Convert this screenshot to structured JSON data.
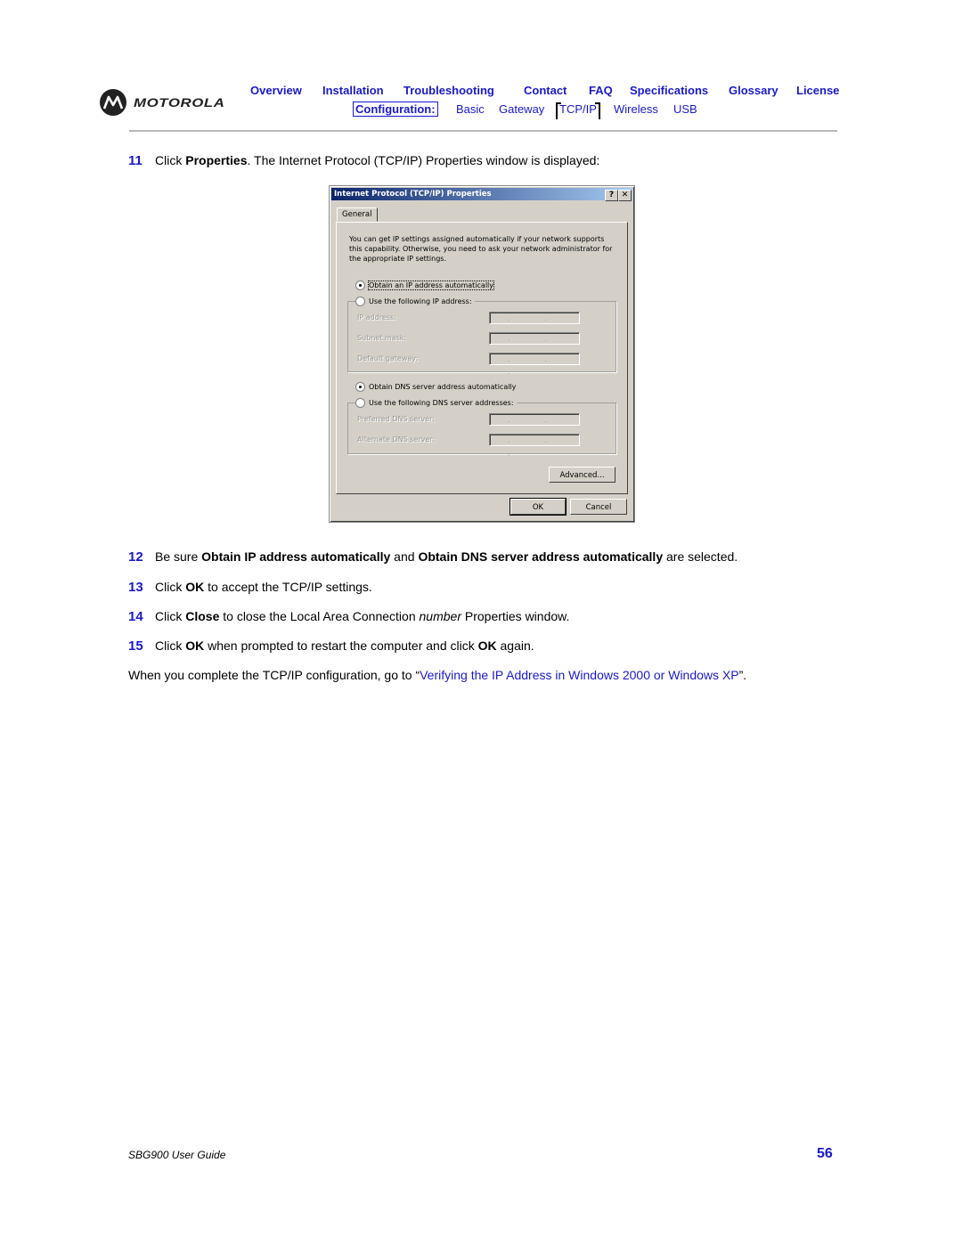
{
  "brand": {
    "name": "MOTOROLA",
    "icon": "motorola-batwing-logo"
  },
  "nav": {
    "top": [
      "Overview",
      "Installation",
      "Troubleshooting",
      "Contact",
      "FAQ",
      "Specifications",
      "Glossary",
      "License"
    ],
    "sub_label": "Configuration:",
    "sub": [
      "Basic",
      "Gateway",
      "TCP/IP",
      "Wireless",
      "USB"
    ],
    "current": "TCP/IP"
  },
  "steps": [
    {
      "num": "11",
      "parts": [
        "Click ",
        "Properties",
        ". The Internet Protocol (TCP/IP) Properties window is displayed:"
      ]
    },
    {
      "num": "12",
      "parts": [
        "Be sure ",
        "Obtain IP address automatically",
        " and ",
        "Obtain DNS server address automatically",
        " are selected."
      ]
    },
    {
      "num": "13",
      "parts": [
        "Click ",
        "OK",
        " to accept the TCP/IP settings."
      ]
    },
    {
      "num": "14",
      "parts": [
        "Click ",
        "Close",
        " to close the Local Area Connection ",
        "number",
        " Properties window."
      ]
    },
    {
      "num": "15",
      "parts": [
        "Click ",
        "OK",
        " when prompted to restart the computer and click ",
        "OK",
        " again."
      ]
    }
  ],
  "closing": {
    "prefix": "When you complete the TCP/IP configuration, go to “",
    "link": "Verifying the IP Address in Windows 2000 or Windows XP",
    "suffix": "”."
  },
  "dialog": {
    "title": "Internet Protocol (TCP/IP) Properties",
    "help_btn": "?",
    "close_btn": "✕",
    "tab": "General",
    "description": "You can get IP settings assigned automatically if your network supports this capability. Otherwise, you need to ask your network administrator for the appropriate IP settings.",
    "ip_auto": "Obtain an IP address automatically",
    "ip_manual": "Use the following IP address:",
    "ip_fields": [
      "IP address:",
      "Subnet mask:",
      "Default gateway:"
    ],
    "dns_auto": "Obtain DNS server address automatically",
    "dns_manual": "Use the following DNS server addresses:",
    "dns_fields": [
      "Preferred DNS server:",
      "Alternate DNS server:"
    ],
    "ip_placeholder": ". . .",
    "ip_auto_selected": true,
    "dns_auto_selected": true,
    "advanced": "Advanced...",
    "ok": "OK",
    "cancel": "Cancel"
  },
  "footer": {
    "title": "SBG900 User Guide",
    "page": "56"
  }
}
